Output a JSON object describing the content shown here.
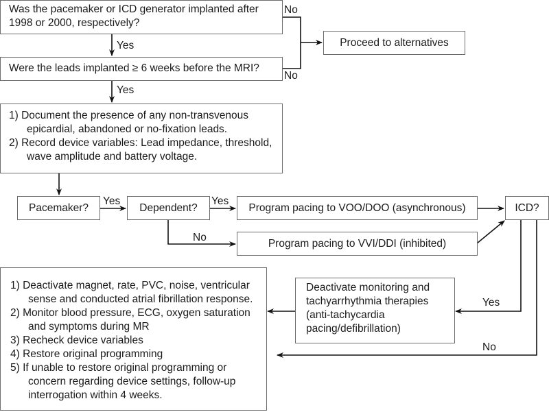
{
  "nodes": {
    "q_generator": "Was the pacemaker or ICD generator implanted after 1998 or 2000, respectively?",
    "q_leads": "Were the leads implanted ≥ 6 weeks before the MRI?",
    "proceed_alternatives": "Proceed to alternatives",
    "document_steps": [
      "1) Document the presence of any non-transvenous epicardial, abandoned or no-fixation leads.",
      "2) Record device variables: Lead impedance, threshold, wave amplitude and battery voltage."
    ],
    "q_pacemaker": "Pacemaker?",
    "q_dependent": "Dependent?",
    "program_voo": "Program pacing to VOO/DOO (asynchronous)",
    "program_vvi": "Program pacing to VVI/DDI (inhibited)",
    "q_icd": "ICD?",
    "deactivate_monitoring": "Deactivate monitoring and tachyarrhythmia therapies (anti-tachycardia pacing/defibrillation)",
    "final_steps": [
      "1) Deactivate magnet, rate, PVC, noise, ventricular sense and conducted atrial fibrillation response.",
      "2) Monitor blood pressure, ECG, oxygen saturation and symptoms during MR",
      "3) Recheck device variables",
      "4) Restore original programming",
      "5) If unable to restore original programming or concern regarding device settings, follow-up interrogation within 4 weeks."
    ]
  },
  "edge_labels": {
    "generator_no": "No",
    "generator_yes": "Yes",
    "leads_no": "No",
    "leads_yes": "Yes",
    "pacemaker_yes": "Yes",
    "dependent_yes": "Yes",
    "dependent_no": "No",
    "icd_yes": "Yes",
    "icd_no": "No"
  }
}
